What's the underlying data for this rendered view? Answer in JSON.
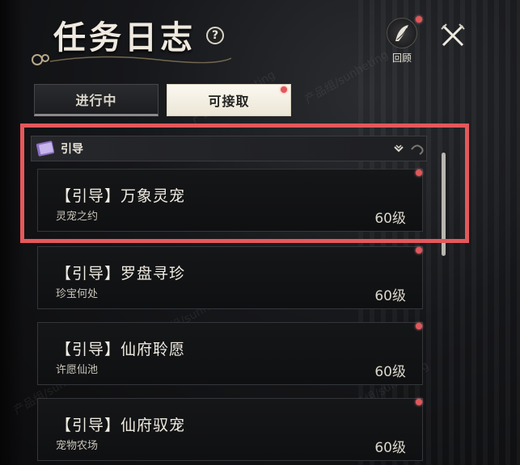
{
  "header": {
    "title": "任务日志",
    "help_icon": "?",
    "review_label": "回顾"
  },
  "tabs": [
    {
      "label": "进行中",
      "active": false
    },
    {
      "label": "可接取",
      "active": true
    }
  ],
  "category": {
    "label": "引导",
    "icon": "book-icon"
  },
  "quests": [
    {
      "title": "【引导】万象灵宠",
      "subtitle": "灵宠之约",
      "level": "60级"
    },
    {
      "title": "【引导】罗盘寻珍",
      "subtitle": "珍宝何处",
      "level": "60级"
    },
    {
      "title": "【引导】仙府聆愿",
      "subtitle": "许愿仙池",
      "level": "60级"
    },
    {
      "title": "【引导】仙府驭宠",
      "subtitle": "宠物农场",
      "level": "60级"
    }
  ],
  "watermark": "产品组/sunheting",
  "colors": {
    "highlight": "#e4585b",
    "notify_dot": "#e0575b",
    "active_tab": "#f5f1e6"
  }
}
